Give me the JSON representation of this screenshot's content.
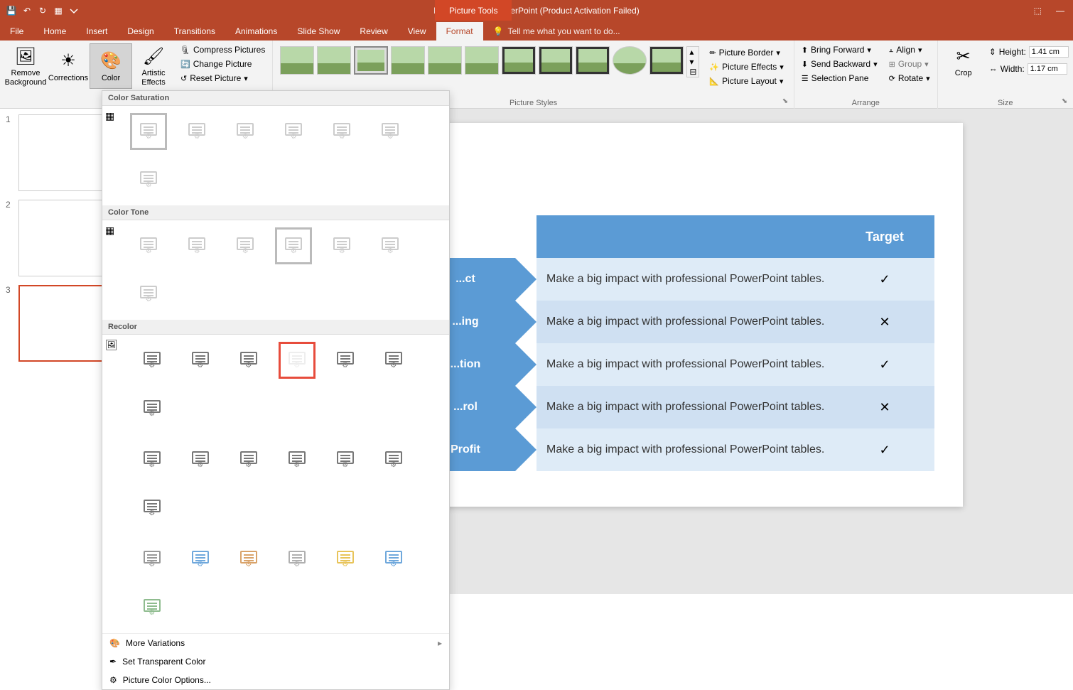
{
  "title": "Presentation1 - PowerPoint (Product Activation Failed)",
  "context_tab": "Picture Tools",
  "tabs": [
    "File",
    "Home",
    "Insert",
    "Design",
    "Transitions",
    "Animations",
    "Slide Show",
    "Review",
    "View",
    "Format"
  ],
  "tellme": "Tell me what you want to do...",
  "ribbon": {
    "remove_bg": "Remove\nBackground",
    "corrections": "Corrections",
    "color": "Color",
    "artistic": "Artistic\nEffects",
    "compress": "Compress Pictures",
    "change": "Change Picture",
    "reset": "Reset Picture",
    "border": "Picture Border",
    "effects": "Picture Effects",
    "layout": "Picture Layout",
    "bring_fwd": "Bring Forward",
    "send_back": "Send Backward",
    "sel_pane": "Selection Pane",
    "align": "Align",
    "group": "Group",
    "rotate": "Rotate",
    "crop": "Crop",
    "height_label": "Height:",
    "width_label": "Width:",
    "height_val": "1.41 cm",
    "width_val": "1.17 cm",
    "group_styles": "Picture Styles",
    "group_arrange": "Arrange",
    "group_size": "Size"
  },
  "dropdown": {
    "saturation": "Color Saturation",
    "tone": "Color Tone",
    "recolor": "Recolor",
    "more_var": "More Variations",
    "set_trans": "Set Transparent Color",
    "pic_opts": "Picture Color Options..."
  },
  "slide": {
    "target_header": "Target",
    "rows": [
      {
        "label": "...ct",
        "desc": "Make a big impact with professional PowerPoint tables.",
        "target": "✓"
      },
      {
        "label": "...ing",
        "desc": "Make a big impact with professional PowerPoint tables.",
        "target": "✕"
      },
      {
        "label": "...tion",
        "desc": "Make a big impact with professional PowerPoint tables.",
        "target": "✓"
      },
      {
        "label": "...rol",
        "desc": "Make a big impact with professional PowerPoint tables.",
        "target": "✕"
      },
      {
        "label": "Profit",
        "desc": "Make a big impact with professional PowerPoint tables.",
        "target": "✓"
      }
    ]
  },
  "thumbs": [
    1,
    2,
    3
  ],
  "recolor_accents": [
    "#999",
    "#6fa8dc",
    "#d9a36a",
    "#b0b0b0",
    "#e8c45a",
    "#6fa8dc",
    "#8fbc8f"
  ]
}
